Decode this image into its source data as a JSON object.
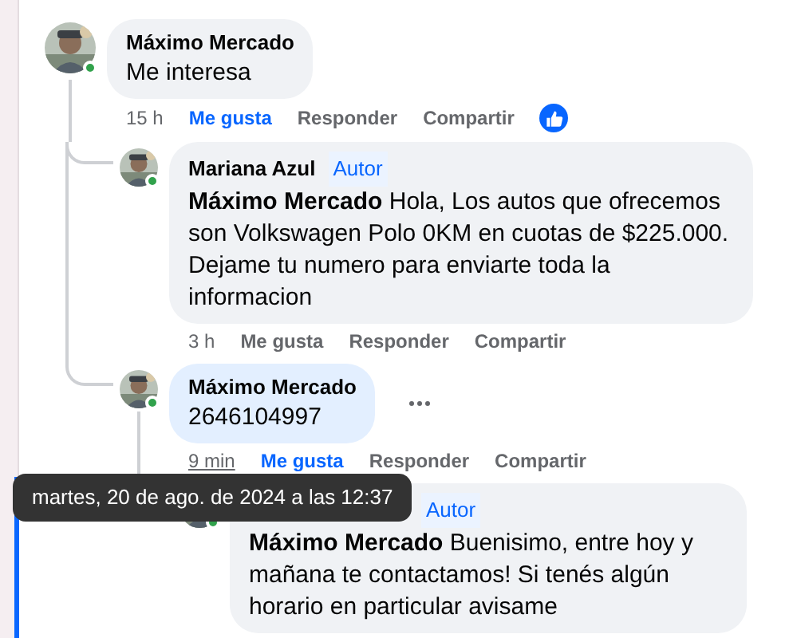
{
  "comments": [
    {
      "author": "Máximo Mercado",
      "text": "Me interesa",
      "time": "15 h",
      "online": true,
      "liked": true,
      "bubble_highlighted": false,
      "focused": false,
      "time_hovered": false,
      "reaction": true,
      "more_button": false,
      "actions": [
        "Me gusta",
        "Responder",
        "Compartir"
      ],
      "children": [
        {
          "author": "Mariana Azul",
          "badge": "Autor",
          "text": "**Máximo Mercado** Hola, Los autos que ofrecemos son Volkswagen Polo 0KM en cuotas de $225.000. Dejame tu numero para enviarte toda la informacion",
          "time": "3 h",
          "online": true,
          "liked": false,
          "bubble_highlighted": false,
          "focused": false,
          "time_hovered": false,
          "reaction": false,
          "more_button": false,
          "actions": [
            "Me gusta",
            "Responder",
            "Compartir"
          ]
        },
        {
          "author": "Máximo Mercado",
          "text": "2646104997",
          "time": "9 min",
          "online": true,
          "liked": true,
          "bubble_highlighted": true,
          "focused": false,
          "time_hovered": true,
          "reaction": false,
          "more_button": true,
          "actions": [
            "Me gusta",
            "Responder",
            "Compartir"
          ],
          "children": [
            {
              "badge": "Autor",
              "text": "**Máximo Mercado** Buenisimo, entre hoy y mañana te contactamos! Si tenés algún horario en particular avisame",
              "online": true,
              "liked": false,
              "bubble_highlighted": false,
              "focused": true,
              "time_hovered": false,
              "reaction": false,
              "more_button": false
            }
          ]
        }
      ]
    }
  ],
  "tooltip": "martes, 20 de ago. de 2024 a las 12:37"
}
